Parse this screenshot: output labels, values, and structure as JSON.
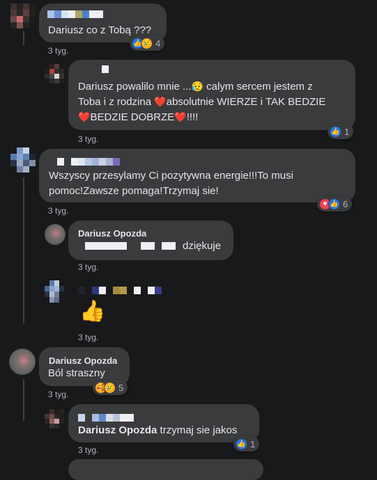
{
  "colors": {
    "background": "#18191a",
    "bubble": "#3a3b3c",
    "text": "#e4e6eb",
    "meta": "#b0b3b8",
    "like": "#2078f4",
    "love": "#f33e58"
  },
  "comments": [
    {
      "text": "Dariusz co z Tobą ???",
      "time": "3 tyg.",
      "reaction_count": "4",
      "reactions": [
        "like-icon",
        "sad-icon"
      ]
    },
    {
      "line1": "Dariusz powalilo mnie ...",
      "line1b": "calym sercem jestem z",
      "line2a": "Toba i z rodzina ",
      "line2b": "absolutnie WIERZE i TAK BEDZIE",
      "line3a": "BEDZIE DOBRZE",
      "line3b": "!!!!",
      "time": "3 tyg.",
      "reaction_count": "1",
      "reactions": [
        "like-icon"
      ]
    },
    {
      "line1": "Wszyscy przesylamy Ci pozytywna energie!!!To musi",
      "line2": "pomoc!Zawsze pomaga!Trzymaj sie!",
      "time": "3 tyg.",
      "reaction_count": "6",
      "reactions": [
        "love-icon",
        "like-icon"
      ]
    },
    {
      "author": "Dariusz Opozda",
      "text": "dziękuje",
      "time": "3 tyg."
    },
    {
      "emoji": "👍",
      "time": "3 tyg."
    },
    {
      "author": "Dariusz Opozda",
      "text": "Ból straszny",
      "time": "3 tyg.",
      "reaction_count": "5",
      "reactions": [
        "care-icon",
        "sad-icon"
      ]
    },
    {
      "mention": "Dariusz Opozda",
      "text": "trzymaj sie jakos",
      "time": "3 tyg.",
      "reaction_count": "1",
      "reactions": [
        "like-icon"
      ]
    }
  ]
}
